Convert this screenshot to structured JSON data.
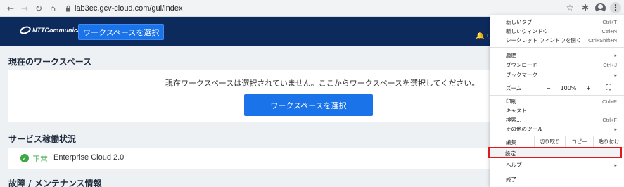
{
  "browser": {
    "url": "lab3ec.gcv-cloud.com/gui/index"
  },
  "header": {
    "logo_text": "NTTCommunications",
    "workspace_button": "ワークスペースを選択",
    "bell_text": "リ"
  },
  "current_workspace": {
    "title": "現在のワークスペース",
    "message": "現在ワークスペースは選択されていません。ここからワークスペースを選択してください。",
    "select_button": "ワークスペースを選択"
  },
  "service_status": {
    "title": "サービス稼働状況",
    "status": "正常",
    "service": "Enterprise Cloud 2.0"
  },
  "maintenance": {
    "title": "故障 / メンテナンス情報"
  },
  "menu": {
    "new_tab": "新しいタブ",
    "new_tab_sc": "Ctrl+T",
    "new_window": "新しいウィンドウ",
    "new_window_sc": "Ctrl+N",
    "incognito": "シークレット ウィンドウを開く",
    "incognito_sc": "Ctrl+Shift+N",
    "history": "履歴",
    "downloads": "ダウンロード",
    "downloads_sc": "Ctrl+J",
    "bookmarks": "ブックマーク",
    "zoom": "ズーム",
    "zoom_minus": "−",
    "zoom_value": "100%",
    "zoom_plus": "+",
    "print": "印刷...",
    "print_sc": "Ctrl+P",
    "cast": "キャスト...",
    "find": "検索...",
    "find_sc": "Ctrl+F",
    "more_tools": "その他のツール",
    "edit": "編集",
    "cut": "切り取り",
    "copy": "コピー",
    "paste": "貼り付け",
    "settings": "設定",
    "help": "ヘルプ",
    "exit": "終了"
  }
}
